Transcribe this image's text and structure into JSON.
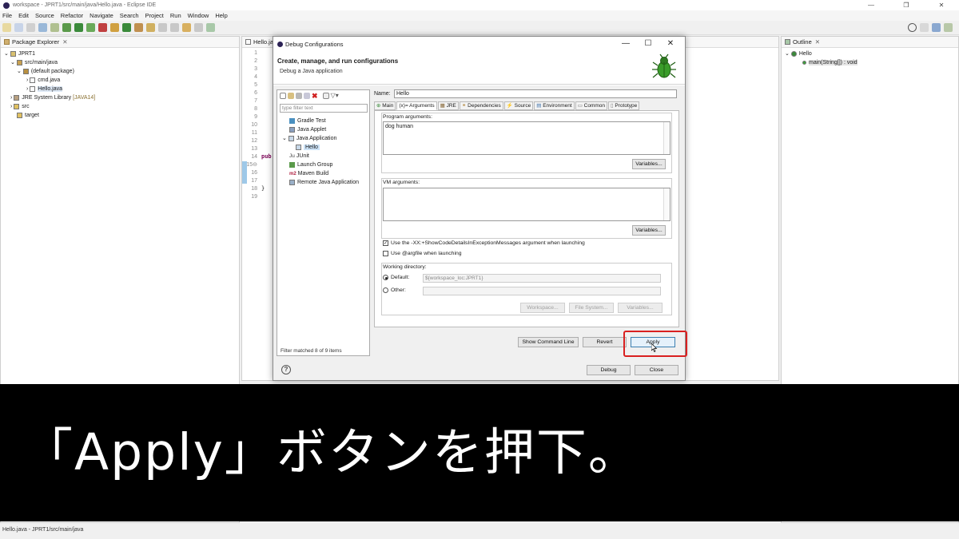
{
  "window": {
    "title": "workspace - JPRT1/src/main/java/Hello.java - Eclipse IDE",
    "minimize": "—",
    "restore": "❐",
    "close": "✕"
  },
  "menu": [
    "File",
    "Edit",
    "Source",
    "Refactor",
    "Navigate",
    "Search",
    "Project",
    "Run",
    "Window",
    "Help"
  ],
  "package_explorer": {
    "title": "Package Explorer",
    "items": [
      {
        "label": "JPRT1",
        "indent": 0
      },
      {
        "label": "src/main/java",
        "indent": 1
      },
      {
        "label": "(default package)",
        "indent": 2
      },
      {
        "label": "cmd.java",
        "indent": 3
      },
      {
        "label": "Hello.java",
        "indent": 3
      },
      {
        "label": "JRE System Library",
        "suffix": "[JAVA14]",
        "indent": 1
      },
      {
        "label": "src",
        "indent": 1
      },
      {
        "label": "target",
        "indent": 1
      }
    ]
  },
  "editor": {
    "tab": "Hello.ja",
    "lines": [
      "1",
      "2",
      "3",
      "4",
      "5",
      "6",
      "7",
      "8",
      "9",
      "10",
      "11",
      "12",
      "13",
      "14",
      "15⊖",
      "16",
      "17",
      "18",
      "19"
    ],
    "code_fragment": "pub",
    "brace": "}"
  },
  "outline": {
    "title": "Outline",
    "items": [
      "Hello",
      "main(String[]) : void"
    ]
  },
  "dialog": {
    "title": "Debug Configurations",
    "header_title": "Create, manage, and run configurations",
    "header_subtitle": "Debug a Java application",
    "filter_placeholder": "type filter text",
    "tree": [
      {
        "label": "Gradle Test",
        "indent": 1
      },
      {
        "label": "Java Applet",
        "indent": 1
      },
      {
        "label": "Java Application",
        "indent": 1
      },
      {
        "label": "Hello",
        "indent": 2
      },
      {
        "label": "JUnit",
        "indent": 1
      },
      {
        "label": "Launch Group",
        "indent": 1
      },
      {
        "label": "Maven Build",
        "indent": 1
      },
      {
        "label": "Remote Java Application",
        "indent": 1
      }
    ],
    "filter_status": "Filter matched 8 of 9 items",
    "name_label": "Name:",
    "name_value": "Hello",
    "tabs": [
      "Main",
      "(x)= Arguments",
      "JRE",
      "Dependencies",
      "Source",
      "Environment",
      "Common",
      "Prototype"
    ],
    "active_tab": "(x)= Arguments",
    "program_args_label": "Program arguments:",
    "program_args_value": "dog human",
    "variables_label": "Variables...",
    "vm_args_label": "VM arguments:",
    "vm_args_value": "",
    "checkbox_show_code": "Use the -XX:+ShowCodeDetailsInExceptionMessages argument when launching",
    "checkbox_argfile": "Use @argfile when launching",
    "working_dir_label": "Working directory:",
    "default_label": "Default:",
    "default_value": "${workspace_loc:JPRT1}",
    "other_label": "Other:",
    "workspace_btn": "Workspace...",
    "filesystem_btn": "File System...",
    "variables_btn": "Variables...",
    "show_cmd_btn": "Show Command Line",
    "revert_btn": "Revert",
    "apply_btn": "Apply",
    "debug_btn": "Debug",
    "close_btn": "Close",
    "help": "?"
  },
  "caption": "「Apply」ボタンを押下。",
  "status_bar": "Hello.java - JPRT1/src/main/java",
  "colors": {
    "highlight": "#d92020",
    "bug": "#3a9c2a"
  }
}
